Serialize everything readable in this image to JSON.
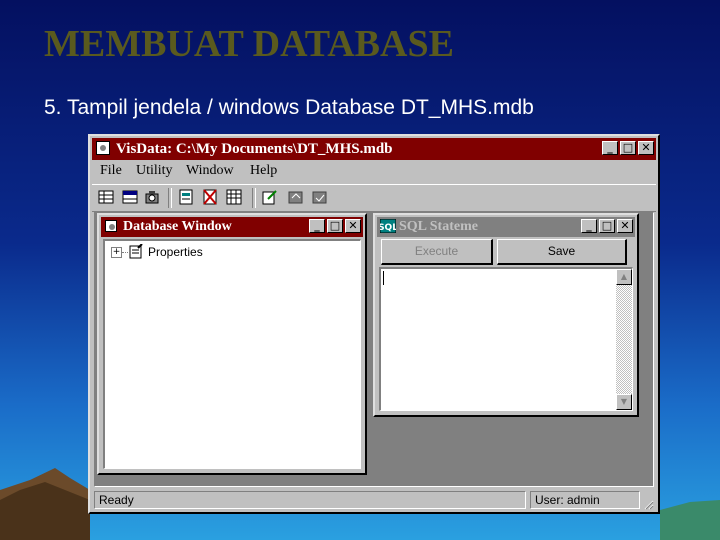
{
  "slide": {
    "title": "MEMBUAT  DATABASE",
    "subtitle": "5. Tampil jendela / windows Database  DT_MHS.mdb"
  },
  "app": {
    "title": "VisData: C:\\My Documents\\DT_MHS.mdb",
    "controls": {
      "minimize": "_",
      "maximize": "□",
      "close": "✕"
    },
    "menu": [
      "File",
      "Utility",
      "Window",
      "Help"
    ],
    "toolbar_icons": [
      "table-icon",
      "dynaset-icon",
      "snapshot-icon",
      "data-control-icon",
      "no-data-control-icon",
      "grid-icon",
      "begin-transaction-icon",
      "rollback-icon",
      "commit-icon"
    ]
  },
  "database_window": {
    "title": "Database Window",
    "tree": [
      {
        "label": "Properties",
        "expander": "+"
      }
    ]
  },
  "sql_window": {
    "title": "SQL Stateme",
    "execute_label": "Execute",
    "save_label": "Save",
    "sql_text": ""
  },
  "status": {
    "left": "Ready",
    "right": "User: admin"
  },
  "colors": {
    "active_title": "#800000",
    "inactive_title": "#808080",
    "face": "#c0c0c0",
    "slide_title": "#5a5a1e"
  }
}
